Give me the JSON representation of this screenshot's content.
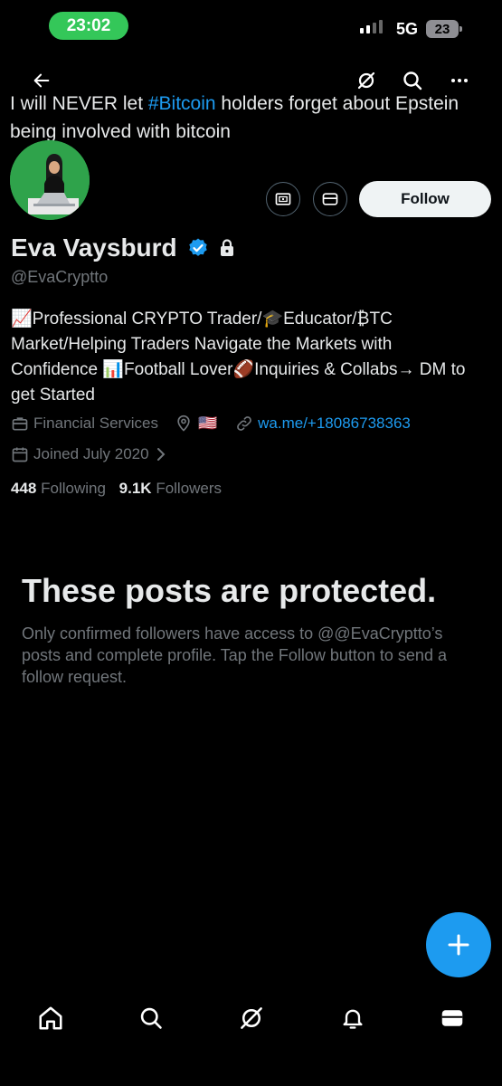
{
  "status_bar": {
    "time": "23:02",
    "network": "5G",
    "battery": "23"
  },
  "header": {
    "back_icon": "arrow-left-icon",
    "grok_icon": "grok-icon",
    "search_icon": "search-icon",
    "more_icon": "more-icon"
  },
  "tweet_overlay": {
    "prefix": "I will NEVER let ",
    "hashtag": "#Bitcoin",
    "suffix": " holders forget about Epstein being involved with bitcoin"
  },
  "profile": {
    "name": "Eva Vaysburd",
    "handle": "@EvaCryptto",
    "follow_label": "Follow",
    "bio": "📈Professional CRYPTO Trader/🎓Educator/₿TC Market/Helping Traders Navigate the Markets with Confidence 📊Football Lover🏈Inquiries & Collabs→ DM to get Started",
    "category": "Financial Services",
    "location": "🇺🇸",
    "website": "wa.me/+18086738363",
    "joined": "Joined July 2020",
    "following_count": "448",
    "following_label": "Following",
    "followers_count": "9.1K",
    "followers_label": "Followers"
  },
  "protected": {
    "title": "These posts are protected.",
    "body": "Only confirmed followers have access to @@EvaCryptto’s posts and complete profile. Tap the Follow button to send a follow request."
  },
  "colors": {
    "accent": "#1d9bf0",
    "background": "#000000",
    "secondary_text": "#71767b",
    "time_pill": "#34c759"
  }
}
